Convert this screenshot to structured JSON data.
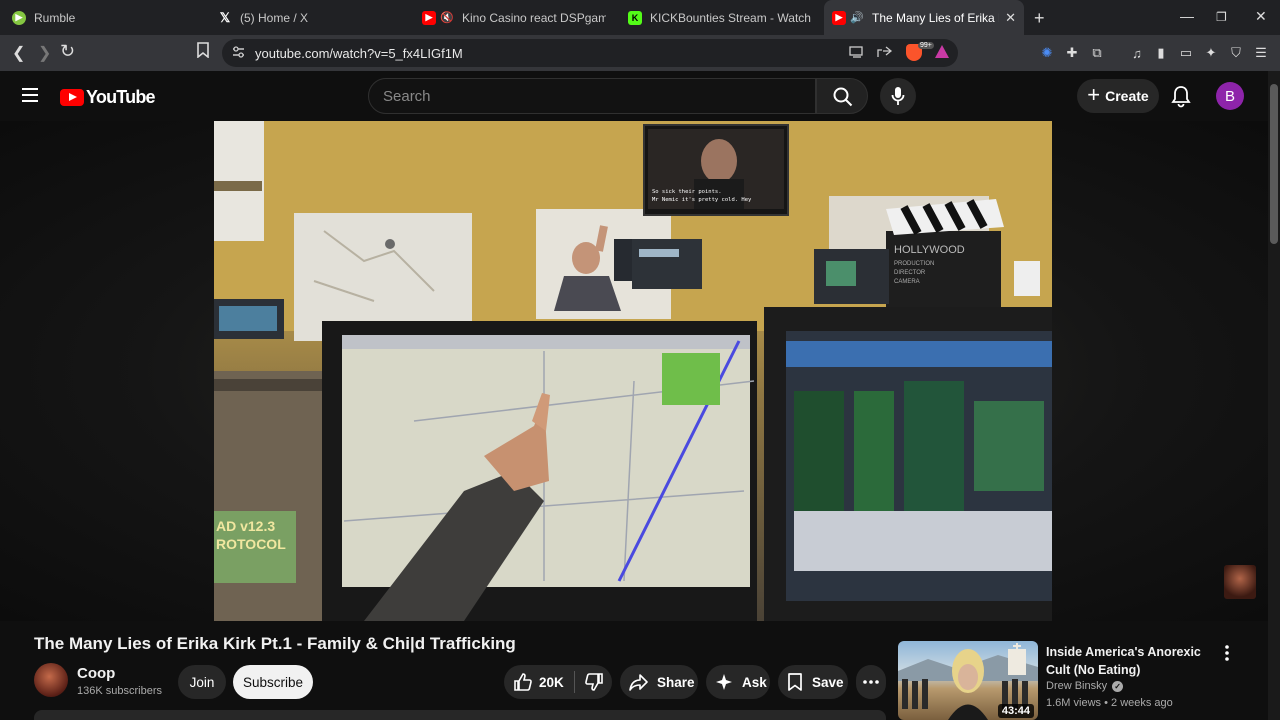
{
  "browser": {
    "tabs": [
      {
        "label": "Rumble",
        "favicon": "rumble-icon",
        "color": "#85c742",
        "active": false
      },
      {
        "label": "(5) Home / X",
        "favicon": "x-icon",
        "color": "#000000",
        "active": false
      },
      {
        "label": "Kino Casino react DSPgamings W",
        "favicon": "youtube-icon",
        "color": "#ff0000",
        "active": false
      },
      {
        "label": "KICKBounties Stream - Watch Live on",
        "favicon": "kick-icon",
        "color": "#53fc18",
        "active": false
      },
      {
        "label": "The Many Lies of Erika Kirk Pt",
        "favicon": "youtube-icon",
        "color": "#ff0000",
        "active": true
      }
    ],
    "url": "youtube.com/watch?v=5_fx4LIGf1M",
    "brave_badge": "99+"
  },
  "youtube": {
    "logo_text": "YouTube",
    "search_placeholder": "Search",
    "create_label": "Create",
    "avatar_letter": "B",
    "avatar_color": "#8e24aa"
  },
  "video": {
    "title": "The Many Lies of Erika Kirk Pt.1 - Family & Chi|d Trafficking",
    "channel": "Coop",
    "subscribers": "136K subscribers",
    "join_label": "Join",
    "subscribe_label": "Subscribe",
    "likes": "20K",
    "share_label": "Share",
    "ask_label": "Ask",
    "save_label": "Save",
    "scene_text": {
      "tv_caption_1": "So sick their points.",
      "tv_caption_2": "Mr Nemic it's pretty cold. Hey",
      "board_1": "HOLLYWOOD",
      "board_2": "PRODUCTION",
      "board_3": "DIRECTOR",
      "board_4": "CAMERA",
      "sign_1": "AD v12.3",
      "sign_2": "ROTOCOL"
    }
  },
  "recommendation": {
    "title": "Inside America's Anorexic Cult (No Eating)",
    "channel": "Drew Binsky",
    "views": "1.6M views",
    "age": "2 weeks ago",
    "duration": "43:44"
  }
}
